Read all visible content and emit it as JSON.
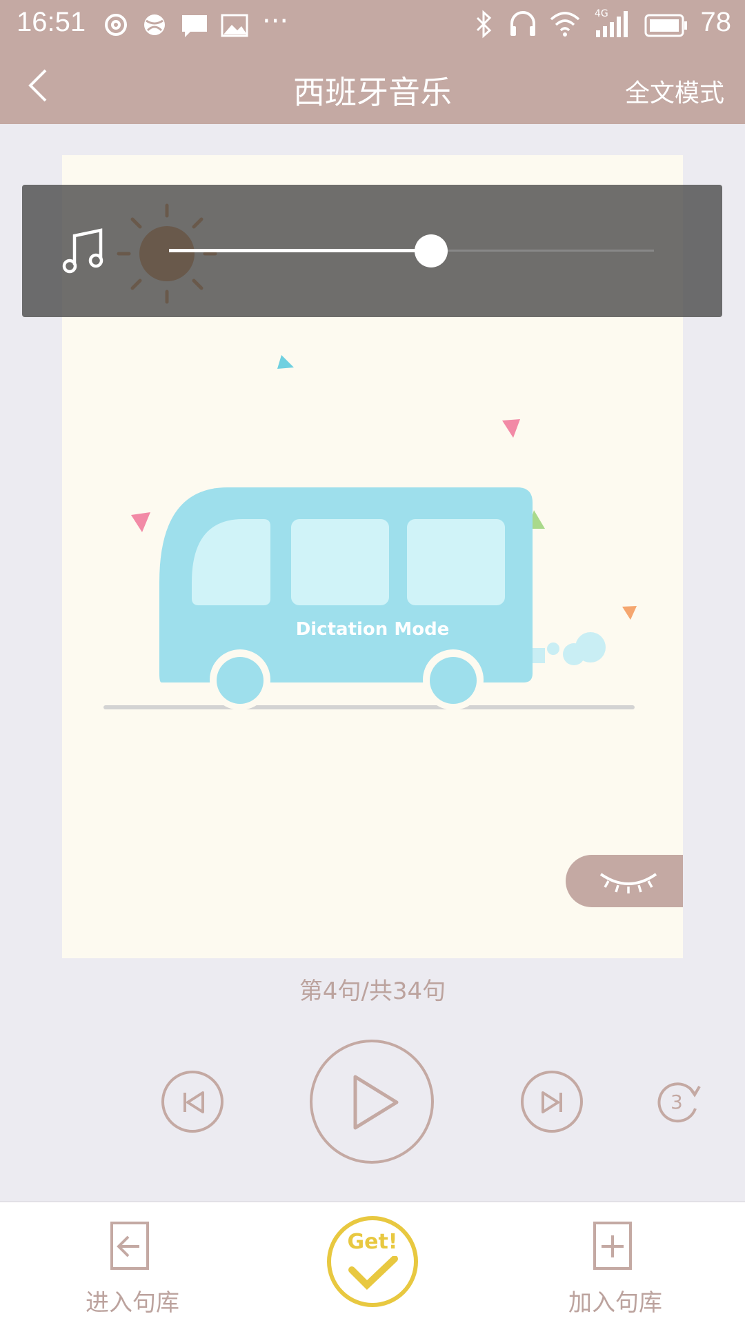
{
  "status_bar": {
    "time": "16:51",
    "battery": "78",
    "network": "4G"
  },
  "header": {
    "title": "西班牙音乐",
    "mode_label": "全文模式"
  },
  "slider": {
    "value_fraction": 0.54
  },
  "card": {
    "illustration_text": "Dictation Mode"
  },
  "counter": "第4句/共34句",
  "controls": {
    "repeat_count": "3"
  },
  "bottom_bar": {
    "left_label": "进入句库",
    "center_badge": "Get!",
    "right_label": "加入句库"
  },
  "colors": {
    "brand": "#c4a9a3",
    "accent_yellow": "#e8c840",
    "card_bg": "#fdfaf0",
    "bus": "#9edfec"
  }
}
